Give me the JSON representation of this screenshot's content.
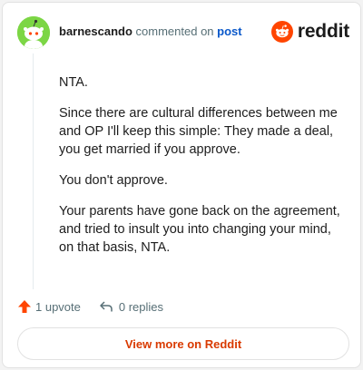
{
  "header": {
    "username": "barnescando",
    "action_text": "commented on",
    "post_link": "post",
    "logo_text": "reddit"
  },
  "comment": {
    "paragraphs": [
      "NTA.",
      "Since there are cultural differences between me and OP I'll keep this simple: They made a deal, you get married if you approve.",
      "You don't approve.",
      "Your parents have gone back on the agreement, and tried to insult you into changing your mind, on that basis, NTA."
    ]
  },
  "actions": {
    "upvote_label": "1 upvote",
    "replies_label": "0 replies"
  },
  "footer": {
    "view_more_label": "View more on Reddit"
  },
  "colors": {
    "brand": "#ff4500",
    "link": "#0a58ca",
    "view_more": "#d93a00",
    "avatar_bg": "#7cd645"
  },
  "icons": [
    "snoo-avatar-icon",
    "reddit-logo-icon",
    "upvote-arrow-icon",
    "reply-arrow-icon"
  ]
}
